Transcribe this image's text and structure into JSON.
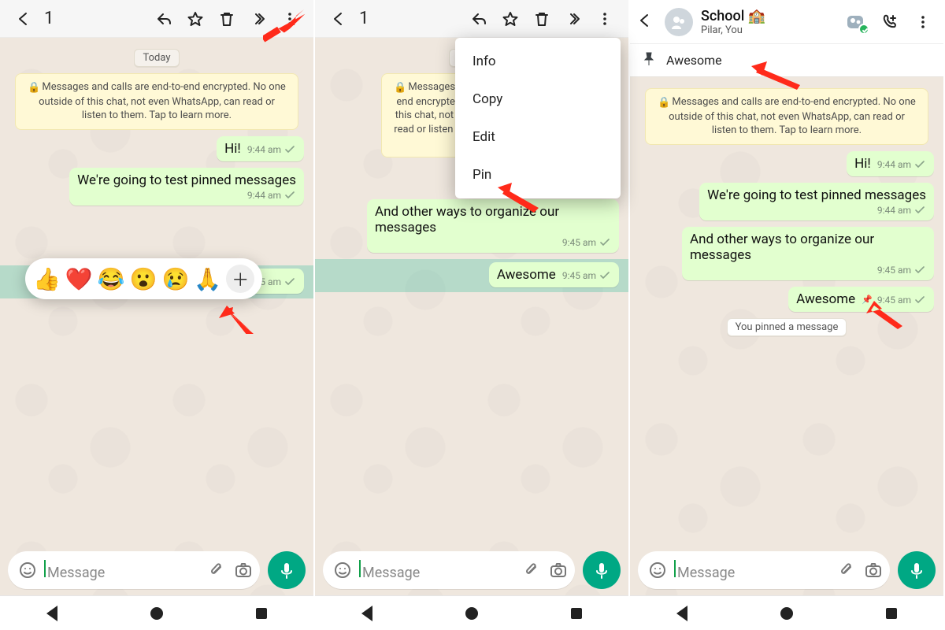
{
  "selection_toolbar": {
    "count": "1"
  },
  "date_chip": "Today",
  "encryption_notice": "Messages and calls are end-to-end encrypted. No one outside of this chat, not even WhatsApp, can read or listen to them. Tap to learn more.",
  "messages": {
    "hi": {
      "text": "Hi!",
      "time": "9:44 am"
    },
    "test": {
      "text": "We're going to test pinned messages",
      "time": "9:44 am"
    },
    "other": {
      "text": "And other ways to organize our messages",
      "time": "9:45 am"
    },
    "awesome": {
      "text": "Awesome",
      "time": "9:45 am"
    }
  },
  "reactions": [
    "👍",
    "❤️",
    "😂",
    "😮",
    "😢",
    "🙏"
  ],
  "menu": {
    "info": "Info",
    "copy": "Copy",
    "edit": "Edit",
    "pin": "Pin"
  },
  "panel3": {
    "group_name": "School 🏫",
    "subtitle": "Pilar, You",
    "pinned_label": "Awesome",
    "system_chip": "You pinned a message"
  },
  "input": {
    "placeholder": "Message"
  }
}
